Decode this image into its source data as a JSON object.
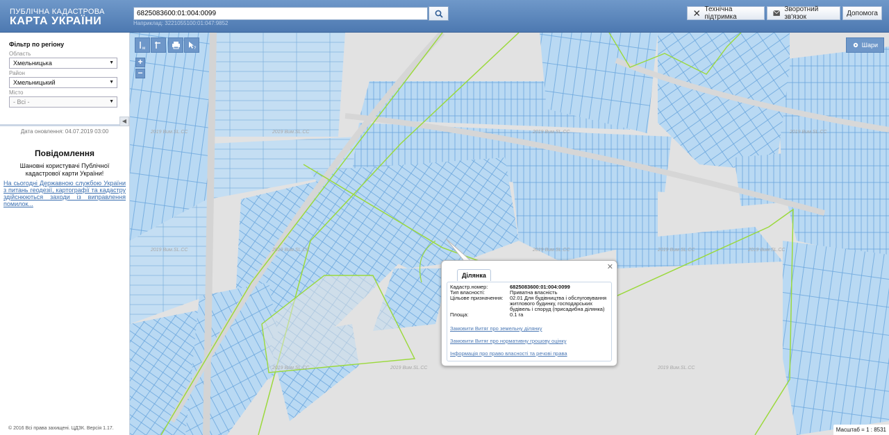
{
  "header": {
    "brand_top": "ПУБЛІЧНА КАДАСТРОВА",
    "brand_main": "КАРТА УКРАЇНИ",
    "search_value": "6825083600:01:004:0099",
    "search_hint": "Наприклад: 3221055100:01:047:9852",
    "buttons": {
      "support": "Технічна підтримка",
      "feedback": "Зворотний зв'язок",
      "help": "Допомога"
    }
  },
  "sidebar": {
    "filter_title": "Фільтр по регіону",
    "region_label": "Область",
    "region_value": "Хмельницька",
    "district_label": "Район",
    "district_value": "Хмельницький",
    "city_label": "Місто",
    "city_value": "- Всі -",
    "updated": "Дата оновлення: 04.07.2019 03:00",
    "notice_title": "Повідомлення",
    "notice_text": "Шановні користувачі Публічної кадастрової карти України!",
    "notice_link": "На сьогодні Державною службою України з питань геодезії, картографії та кадастру здійснюються заходи із виправлення помилок...",
    "copyright": "© 2016 Всі права захищені. ЦДЗК. Версія 1.17."
  },
  "map": {
    "layers_label": "Шари",
    "scale_text": "Масштаб = 1 : 8531",
    "watermark": "2019 Вим.SL.CC",
    "colors": {
      "parcel_fill": "#b9d9f3",
      "parcel_stroke": "#6aa6dd",
      "boundary": "#9bd93c",
      "background": "#e2e2e2"
    }
  },
  "popup": {
    "tab_label": "Ділянка",
    "rows": [
      {
        "k": "Кадастр.номер:",
        "v": "6825083600:01:004:0099"
      },
      {
        "k": "Тип власності:",
        "v": "Приватна власність"
      },
      {
        "k": "Цільове призначення:",
        "v": "02.01 Для будівництва і обслуговування житлового будинку, господарських будівель і споруд (присадибна ділянка)"
      },
      {
        "k": "Площа:",
        "v": "0.1 га"
      }
    ],
    "links": [
      "Замовити Витяг про земельну ділянку",
      "Замовити Витяг про нормативну грошову оцінку",
      "Інформація про право власності та речові права"
    ]
  }
}
